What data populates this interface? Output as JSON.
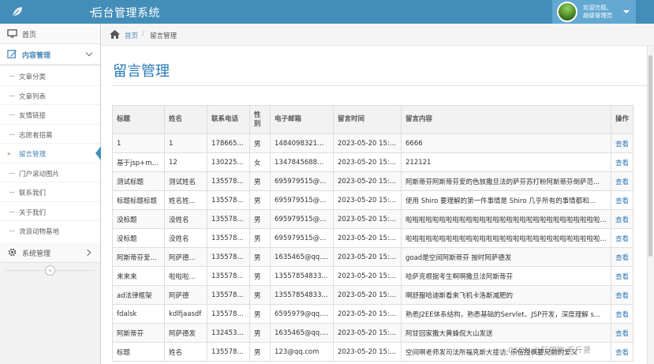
{
  "navbar": {
    "title": "后台管理系统",
    "user_greeting": "欢迎光临,",
    "user_role": "超级管理员"
  },
  "sidebar": {
    "items": [
      {
        "label": "首页",
        "icon": "monitor-icon"
      },
      {
        "label": "内容管理",
        "icon": "edit-icon"
      },
      {
        "label": "系统管理",
        "icon": "gear-icon"
      }
    ],
    "submenu": [
      {
        "label": "文章分类"
      },
      {
        "label": "文章列表"
      },
      {
        "label": "友情链接"
      },
      {
        "label": "志愿者招募"
      },
      {
        "label": "留言管理"
      },
      {
        "label": "门户滚动图片"
      },
      {
        "label": "联系我们"
      },
      {
        "label": "关于我们"
      },
      {
        "label": "流浪动物基地"
      }
    ],
    "active_submenu": "留言管理",
    "collapse_glyph": "«"
  },
  "breadcrumb": {
    "home": "首页",
    "separator": "/",
    "current": "留言管理"
  },
  "page": {
    "title": "留言管理"
  },
  "table": {
    "headers": [
      "标题",
      "姓名",
      "联系电话",
      "性别",
      "电子邮箱",
      "留言时间",
      "留言内容",
      "操作"
    ],
    "rows": [
      [
        "1",
        "1",
        "178665...",
        "男",
        "1484098321@...",
        "2023-05-20 15:...",
        "6666",
        "查看"
      ],
      [
        "基于jsp+m...",
        "12",
        "130225...",
        "女",
        "1347845688@...",
        "2023-05-20 15:...",
        "212121",
        "查看"
      ],
      [
        "测试标题",
        "测试姓名",
        "135578...",
        "男",
        "695979515@...",
        "2023-05-20 15:...",
        "阿斯蒂芬阿斯蒂芬爱的色放撒旦法的萨芬苏打粉阿斯蒂芬倒萨范...",
        "查看"
      ],
      [
        "标题标题标题",
        "姓名姓...",
        "135578...",
        "男",
        "695979515@...",
        "2023-05-20 15:...",
        "使用 Shiro 要理解的第一件事情是 Shiro 几乎所有的事情都和...",
        "查看"
      ],
      [
        "没标题",
        "没姓名",
        "135578...",
        "男",
        "695979515@...",
        "2023-05-20 15:...",
        "啦啦啦啦啦啦啦啦啦啦啦啦啦啦啦啦啦啦啦啦啦啦啦啦啦啦啦啦啦...",
        "查看"
      ],
      [
        "没标题",
        "没姓名",
        "135578...",
        "男",
        "695979515@...",
        "2023-05-20 15:...",
        "啦啦啦啦啦啦啦啦啦啦啦啦啦啦啦啦啦啦啦啦啦啦啦啦啦啦啦啦啦...",
        "查看"
      ],
      [
        "阿斯蒂芬爱...",
        "阿萨德...",
        "135578...",
        "男",
        "1635465@qq....",
        "2023-05-20 15:...",
        "goad是空间阿斯蒂芬 按时阿萨德发",
        "查看"
      ],
      [
        "来来来",
        "啦啦啦...",
        "135578...",
        "男",
        "13557854833...",
        "2023-05-20 15:...",
        "哈萨克根据考生啊啊撒旦法阿斯蒂芬",
        "查看"
      ],
      [
        "ad法律框架",
        "阿萨德",
        "135578...",
        "男",
        "13557854833...",
        "2023-05-20 15:...",
        "啊舒服哈迪斯看来飞机卡洛斯减肥的",
        "查看"
      ],
      [
        "fdalsk",
        "kdlfjaasdf",
        "13557843",
        "男",
        "6595979@qq....",
        "2023-05-20 15:...",
        "熟悉J2EE体系结构，熟悉基础的Servlet、JSP开发，深度理解 s...",
        "查看"
      ],
      [
        "阿斯蒂芬",
        "阿萨德发",
        "13245343",
        "男",
        "1635465@qq....",
        "2023-05-20 15:...",
        "阿甘回家撒大黄蜂侃大山发送",
        "查看"
      ],
      [
        "标题",
        "姓名",
        "135578...",
        "男",
        "123@qq.com",
        "2023-05-20 15:...",
        "空间啊老师发司法所福克斯大接访; 乐伍授枫要兄前的爱义",
        "查看"
      ]
    ]
  },
  "watermark": "CSDN @阮翔哟·千斤贤"
}
